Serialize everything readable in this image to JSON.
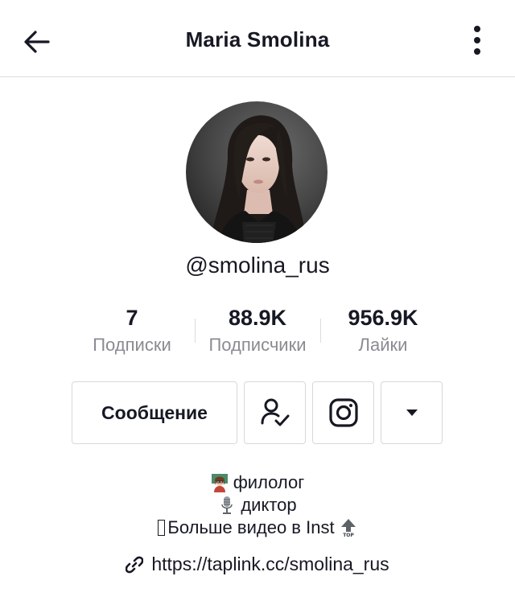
{
  "header": {
    "title": "Maria Smolina"
  },
  "profile": {
    "username": "@smolina_rus"
  },
  "stats": [
    {
      "value": "7",
      "label": "Подписки"
    },
    {
      "value": "88.9K",
      "label": "Подписчики"
    },
    {
      "value": "956.9K",
      "label": "Лайки"
    }
  ],
  "actions": {
    "message_label": "Сообщение"
  },
  "bio": {
    "line1": "филолог",
    "line2": "диктор",
    "line3": "Больше видео в Inst"
  },
  "link": {
    "url": "https://taplink.cc/smolina_rus"
  },
  "icons": {
    "back": "arrow-left-icon",
    "more": "more-vertical-icon",
    "following": "user-check-icon",
    "instagram": "instagram-icon",
    "dropdown": "caret-down-icon",
    "link": "link-icon"
  },
  "colors": {
    "text": "#161823",
    "muted": "#8a8b91",
    "border": "#d8d8d8"
  }
}
